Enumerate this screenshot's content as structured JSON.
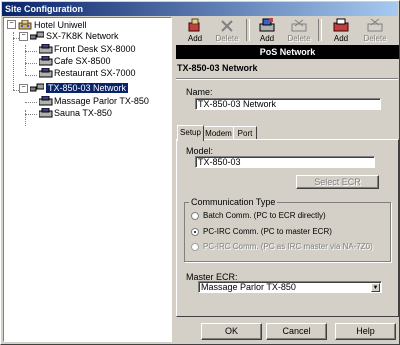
{
  "window": {
    "title": "Site Configuration"
  },
  "tree": {
    "root": "Hotel Uniwell",
    "networks": [
      {
        "label": "SX-7K8K Network",
        "items": [
          "Front Desk SX-8000",
          "Cafe SX-8500",
          "Restaurant SX-7000"
        ]
      },
      {
        "label": "TX-850-03 Network",
        "items": [
          "Massage Parlor TX-850",
          "Sauna TX-850"
        ]
      }
    ]
  },
  "toolbar": {
    "buttons": [
      {
        "label": "Add",
        "enabled": true
      },
      {
        "label": "Delete",
        "enabled": false
      },
      {
        "label": "Add",
        "enabled": true
      },
      {
        "label": "Delete",
        "enabled": false
      },
      {
        "label": "Add",
        "enabled": true
      },
      {
        "label": "Delete",
        "enabled": false
      }
    ]
  },
  "header": {
    "title": "PoS Network"
  },
  "network_title": "TX-850-03 Network",
  "name_field": {
    "label": "Name:",
    "value": "TX-850-03 Network"
  },
  "tabs": [
    "Setup",
    "Modem",
    "Port"
  ],
  "setup": {
    "model_label": "Model:",
    "model_value": "TX-850-03",
    "select_ecr_label": "Select ECR",
    "comm_group_title": "Communication Type",
    "comm_options": [
      {
        "label": "Batch Comm. (PC to ECR directly)",
        "checked": false,
        "enabled": true
      },
      {
        "label": "PC-IRC Comm. (PC to master ECR)",
        "checked": true,
        "enabled": true
      },
      {
        "label": "PC-IRC Comm. (PC as IRC master via NA-7Z0)",
        "checked": false,
        "enabled": false
      }
    ],
    "master_ecr_label": "Master ECR:",
    "master_ecr_value": "Massage Parlor TX-850"
  },
  "footer": {
    "ok": "OK",
    "cancel": "Cancel",
    "help": "Help"
  }
}
